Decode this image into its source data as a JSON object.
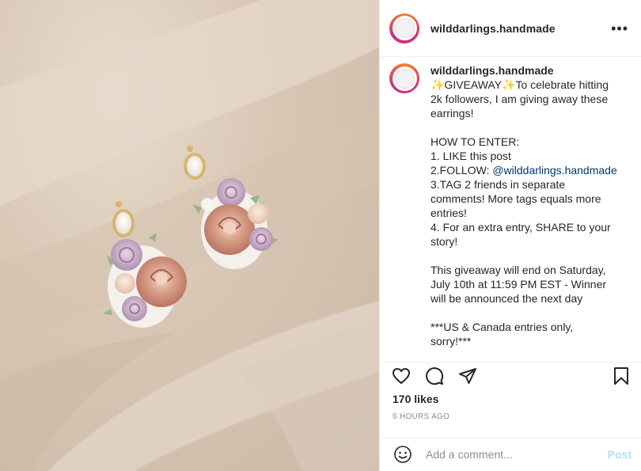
{
  "post": {
    "username": "wilddarlings.handmade",
    "more_icon": "more-horizontal-icon",
    "photo_alt": "Handmade floral polymer clay earrings on satin fabric"
  },
  "caption": {
    "username": "wilddarlings.handmade",
    "lines": [
      "✨GIVEAWAY✨To celebrate hitting",
      "2k followers, I am giving away these",
      "earrings!",
      "",
      "HOW TO ENTER:",
      "1. LIKE this post",
      "2.FOLLOW: ",
      "3.TAG 2 friends in separate",
      "comments! More tags equals more",
      "entries!",
      "4. For an extra entry, SHARE to your",
      "story!",
      "",
      "This giveaway will end on Saturday,",
      "July 10th at 11:59 PM EST - Winner",
      "will be announced the next day",
      "",
      "***US & Canada entries only,",
      "sorry!***"
    ],
    "mention": "@wilddarlings.handmade"
  },
  "actions": {
    "like_icon": "heart-icon",
    "comment_icon": "comment-icon",
    "share_icon": "share-icon",
    "save_icon": "bookmark-icon"
  },
  "likes": "170 likes",
  "timestamp": "6 HOURS AGO",
  "comment": {
    "placeholder": "Add a comment...",
    "post_label": "Post",
    "emoji_icon": "emoji-icon"
  },
  "colors": {
    "text": "#262626",
    "secondary": "#8e8e8e",
    "link": "#00376b",
    "post_disabled": "#b2dffc",
    "border": "#efefef"
  }
}
